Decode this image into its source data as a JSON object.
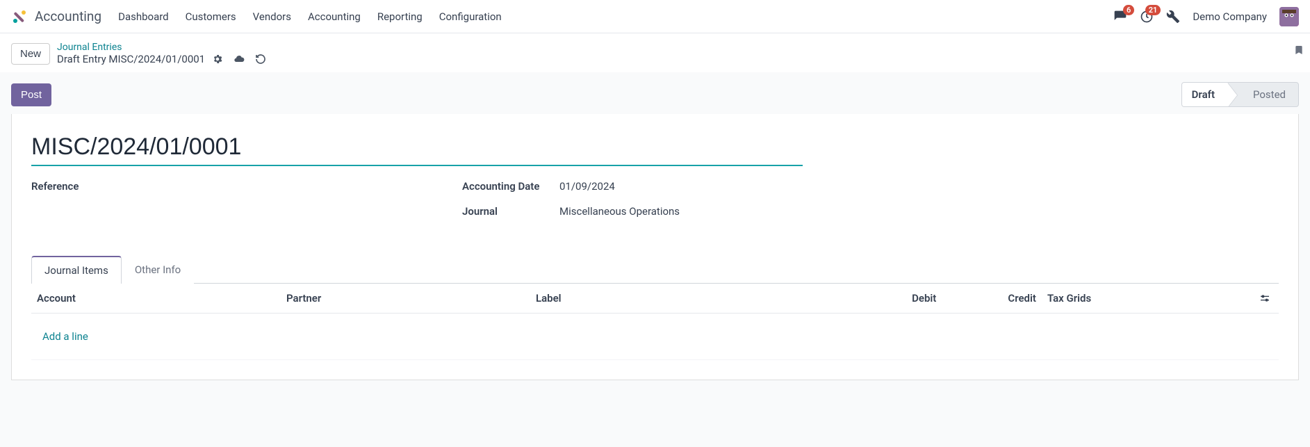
{
  "nav": {
    "app_title": "Accounting",
    "items": [
      "Dashboard",
      "Customers",
      "Vendors",
      "Accounting",
      "Reporting",
      "Configuration"
    ],
    "messages_badge": "6",
    "activities_badge": "21",
    "company": "Demo Company"
  },
  "breadcrumb": {
    "new_label": "New",
    "parent_link": "Journal Entries",
    "current": "Draft Entry MISC/2024/01/0001"
  },
  "actions": {
    "post_label": "Post"
  },
  "status": {
    "steps": [
      "Draft",
      "Posted"
    ],
    "active_index": 0
  },
  "record": {
    "name": "MISC/2024/01/0001",
    "reference_label": "Reference",
    "reference_value": "",
    "date_label": "Accounting Date",
    "date_value": "01/09/2024",
    "journal_label": "Journal",
    "journal_value": "Miscellaneous Operations"
  },
  "tabs": {
    "items": [
      "Journal Items",
      "Other Info"
    ],
    "active_index": 0
  },
  "columns": {
    "account": "Account",
    "partner": "Partner",
    "label": "Label",
    "debit": "Debit",
    "credit": "Credit",
    "tax_grids": "Tax Grids"
  },
  "lines": {
    "add_line": "Add a line"
  }
}
